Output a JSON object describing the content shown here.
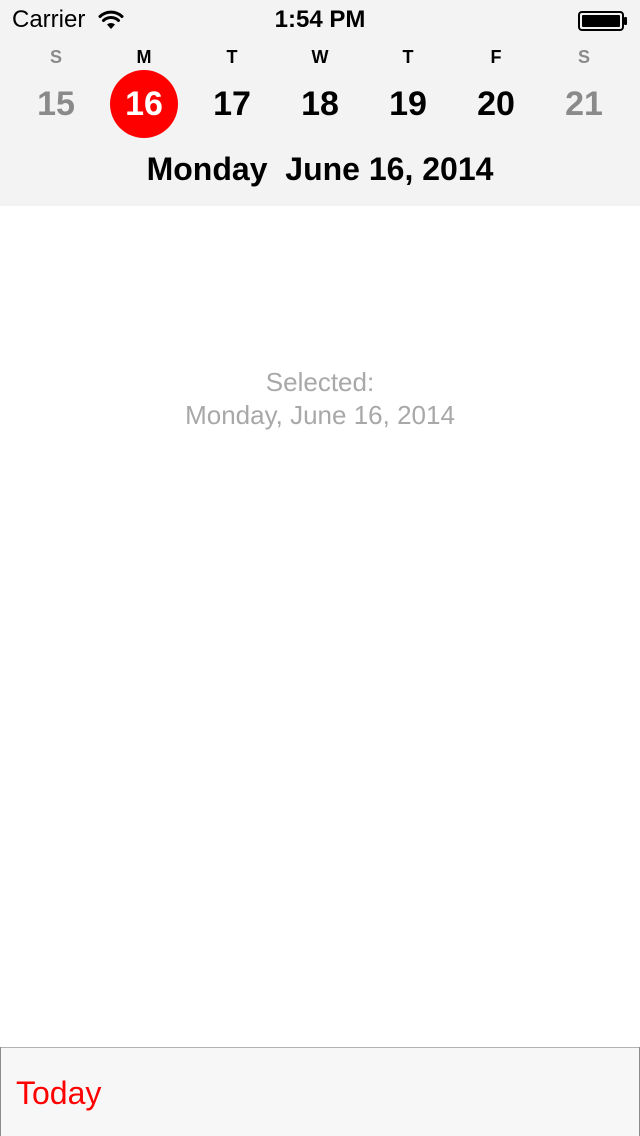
{
  "status_bar": {
    "carrier": "Carrier",
    "time": "1:54 PM",
    "icons": [
      "wifi-icon",
      "battery-icon"
    ]
  },
  "week": {
    "days": [
      {
        "letter": "S",
        "number": "15",
        "weekend": true,
        "selected": false
      },
      {
        "letter": "M",
        "number": "16",
        "weekend": false,
        "selected": true
      },
      {
        "letter": "T",
        "number": "17",
        "weekend": false,
        "selected": false
      },
      {
        "letter": "W",
        "number": "18",
        "weekend": false,
        "selected": false
      },
      {
        "letter": "T",
        "number": "19",
        "weekend": false,
        "selected": false
      },
      {
        "letter": "F",
        "number": "20",
        "weekend": false,
        "selected": false
      },
      {
        "letter": "S",
        "number": "21",
        "weekend": true,
        "selected": false
      }
    ],
    "full_date": "Monday  June 16, 2014"
  },
  "main": {
    "selected_label": "Selected:",
    "selected_value": "Monday, June 16, 2014"
  },
  "toolbar": {
    "today_label": "Today"
  },
  "colors": {
    "accent": "#ff0000",
    "header_bg": "#f3f3f3",
    "weekend_text": "#8a8a8a",
    "placeholder_text": "#a8a8a8"
  }
}
